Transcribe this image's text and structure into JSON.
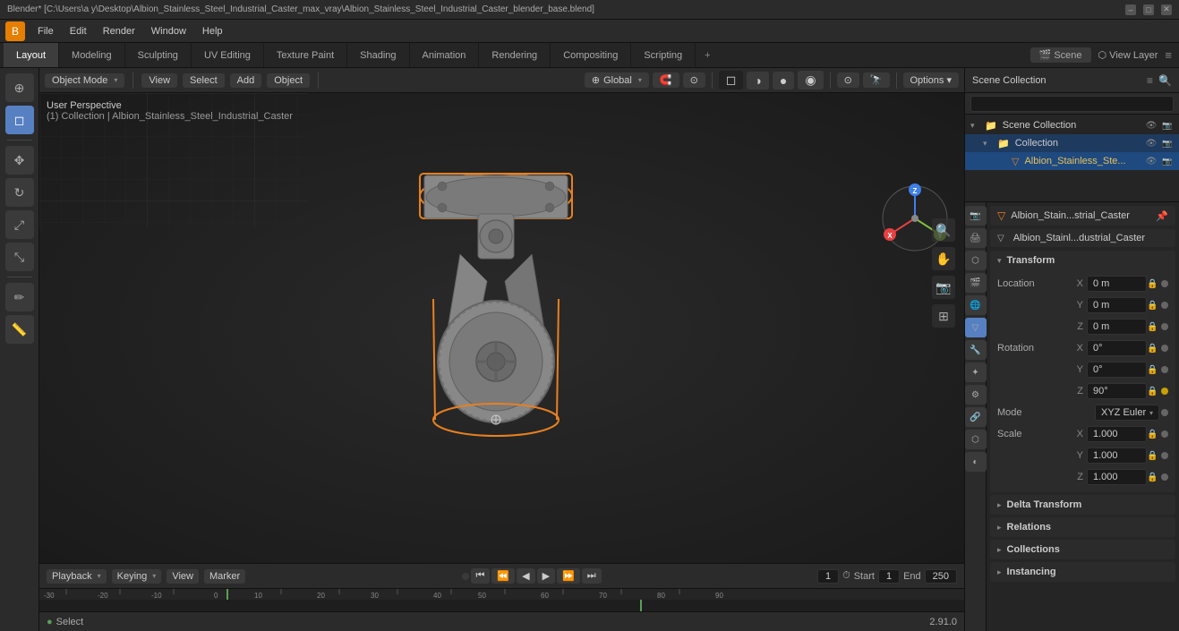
{
  "titlebar": {
    "title": "Blender* [C:\\Users\\a y\\Desktop\\Albion_Stainless_Steel_Industrial_Caster_max_vray\\Albion_Stainless_Steel_Industrial_Caster_blender_base.blend]",
    "min": "–",
    "max": "□",
    "close": "✕"
  },
  "menubar": {
    "items": [
      "Blender",
      "File",
      "Edit",
      "Render",
      "Window",
      "Help"
    ]
  },
  "workspace_tabs": {
    "tabs": [
      "Layout",
      "Modeling",
      "Sculpting",
      "UV Editing",
      "Texture Paint",
      "Shading",
      "Animation",
      "Rendering",
      "Compositing",
      "Scripting"
    ],
    "active": "Layout",
    "plus": "+",
    "scene_label": "Scene",
    "view_layer_label": "View Layer"
  },
  "viewport_header": {
    "mode": "Object Mode",
    "view_label": "View",
    "select_label": "Select",
    "add_label": "Add",
    "object_label": "Object",
    "global": "Global",
    "options": "Options ▾"
  },
  "viewport_info": {
    "perspective": "User Perspective",
    "collection": "(1) Collection | Albion_Stainless_Steel_Industrial_Caster"
  },
  "viewport_controls": {
    "magnify": "🔍",
    "hand": "✋",
    "camera": "📷",
    "grid": "⊞"
  },
  "nav_gizmo": {
    "x_color": "#e84040",
    "y_color": "#80c040",
    "z_color": "#4080e8",
    "center_color": "#888888"
  },
  "timeline": {
    "playback_label": "Playback",
    "keying_label": "Keying",
    "view_label": "View",
    "marker_label": "Marker",
    "frame_current": "1",
    "start_label": "Start",
    "start_frame": "1",
    "end_label": "End",
    "end_frame": "250",
    "transport_buttons": [
      "⏮",
      "⏪",
      "◀",
      "▶",
      "⏩",
      "⏭"
    ]
  },
  "outliner": {
    "title": "Scene Collection",
    "filter_icon": "🔍",
    "scene_collection": "Scene Collection",
    "collection": "Collection",
    "object": "Albion_Stainless_Ste...",
    "object_full": "Albion_Stainless_Steel_Industrial_Caster",
    "search_placeholder": ""
  },
  "properties": {
    "active_object": "Albion_Stain...strial_Caster",
    "active_object_full": "Albion_Stainless_Steel_Industrial_Caster",
    "data_block": "Albion_Stainl...dustrial_Caster",
    "transform_title": "Transform",
    "location_label": "Location",
    "rotation_label": "Rotation",
    "scale_label": "Scale",
    "mode_label": "Mode",
    "mode_value": "XYZ Euler",
    "location_x": "0 m",
    "location_y": "0 m",
    "location_z": "0 m",
    "rotation_x": "0°",
    "rotation_y": "0°",
    "rotation_z": "90°",
    "scale_x": "1.000",
    "scale_y": "1.000",
    "scale_z": "1.000",
    "delta_transform": "Delta Transform",
    "relations": "Relations",
    "collections": "Collections",
    "instancing": "Instancing",
    "x_label": "X",
    "y_label": "Y",
    "z_label": "Z"
  },
  "statusbar": {
    "select": "Select",
    "version": "2.91.0"
  },
  "icons": {
    "cursor": "⊕",
    "move": "✥",
    "rotate": "↻",
    "scale": "⤢",
    "transform": "⤡",
    "shading": "◐",
    "snap": "🧲",
    "annotate": "✏",
    "measure": "📏",
    "arrow": "▶",
    "chevron_down": "▾",
    "chevron_right": "▸",
    "eye": "👁",
    "lock": "🔒",
    "dot": "●",
    "scene_icon": "🎬",
    "object_icon": "▽",
    "mesh_icon": "⬡",
    "collection_icon": "📁",
    "vis_icon": "👁",
    "render_vis": "📷"
  }
}
